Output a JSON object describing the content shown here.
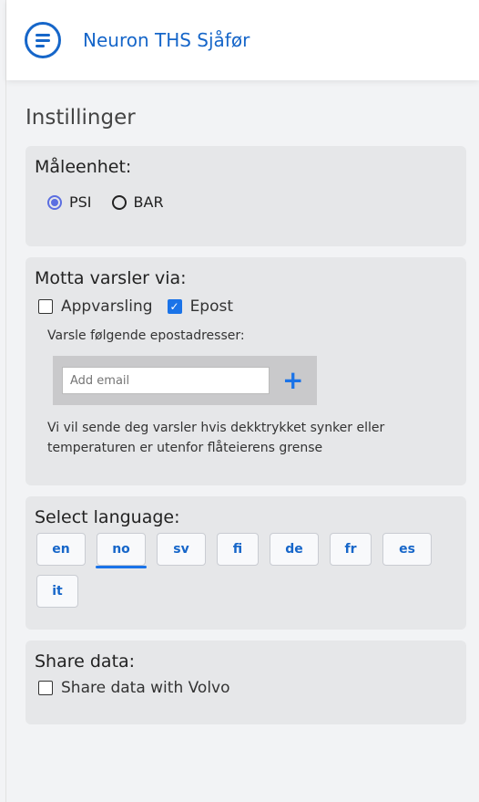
{
  "header": {
    "app_title": "Neuron THS Sjåfør",
    "menu_icon": "menu-list-icon"
  },
  "page": {
    "title": "Instillinger"
  },
  "units": {
    "heading": "Måleenhet:",
    "options": [
      {
        "label": "PSI",
        "selected": true
      },
      {
        "label": "BAR",
        "selected": false
      }
    ]
  },
  "notifications": {
    "heading": "Motta varsler via:",
    "app_label": "Appvarsling",
    "app_checked": false,
    "email_label": "Epost",
    "email_checked": true,
    "recipients_label": "Varsle følgende epostadresser:",
    "email_placeholder": "Add email",
    "add_symbol": "+",
    "notice": "Vi vil sende deg varsler hvis dekktrykket synker eller temperaturen er utenfor flåteierens grense"
  },
  "language": {
    "heading": "Select language:",
    "options": [
      "en",
      "no",
      "sv",
      "fi",
      "de",
      "fr",
      "es",
      "it"
    ],
    "selected": "no"
  },
  "share": {
    "heading": "Share data:",
    "label": "Share data with Volvo",
    "checked": false
  },
  "colors": {
    "accent": "#1666c9",
    "checkbox_checked": "#1a73e8",
    "radio_selected": "#5b6ee1",
    "card_bg": "#e6e7e9"
  }
}
